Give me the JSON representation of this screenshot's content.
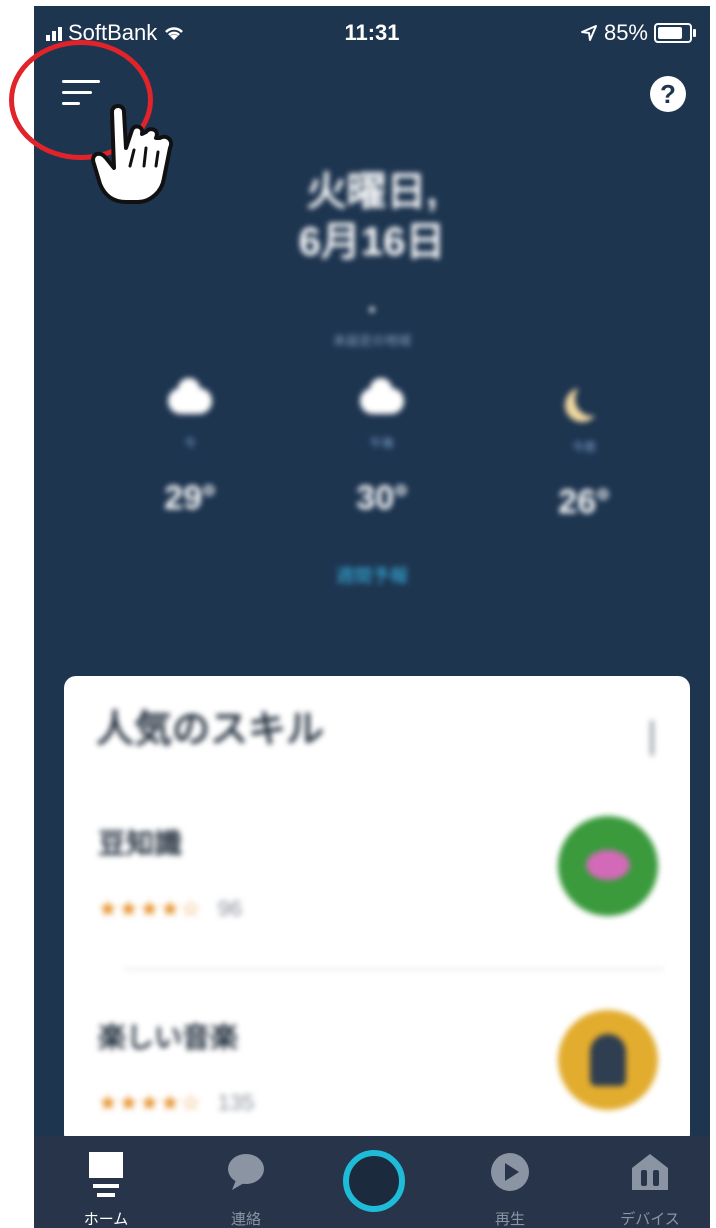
{
  "status_bar": {
    "carrier": "SoftBank",
    "time": "11:31",
    "battery": "85%"
  },
  "header": {
    "help_label": "?"
  },
  "weather": {
    "day": "火曜日,",
    "date": "6月16日",
    "location_mark": "●",
    "location": "未設定の地域",
    "columns": [
      {
        "condition": "今",
        "temp": "29°"
      },
      {
        "condition": "午後",
        "temp": "30°"
      },
      {
        "condition": "今夜",
        "temp": "26°"
      }
    ],
    "forecast_link": "週間予報"
  },
  "card": {
    "title": "人気のスキル",
    "skills": [
      {
        "name": "豆知識",
        "stars": "★★★★☆",
        "count": "96",
        "icon_color": "#3a9a3c"
      },
      {
        "name": "楽しい音楽",
        "stars": "★★★★☆",
        "count": "135",
        "icon_color": "#e2ac2e"
      }
    ]
  },
  "bottom_nav": {
    "items": [
      {
        "label": "ホーム",
        "icon": "home-icon"
      },
      {
        "label": "連絡",
        "icon": "chat-bubble-icon"
      },
      {
        "label": "",
        "icon": "alexa-ring-icon"
      },
      {
        "label": "再生",
        "icon": "play-icon"
      },
      {
        "label": "デバイス",
        "icon": "devices-icon"
      }
    ]
  },
  "colors": {
    "background": "#1e3550",
    "accent": "#1fbcd9",
    "highlight": "#e0242a"
  }
}
